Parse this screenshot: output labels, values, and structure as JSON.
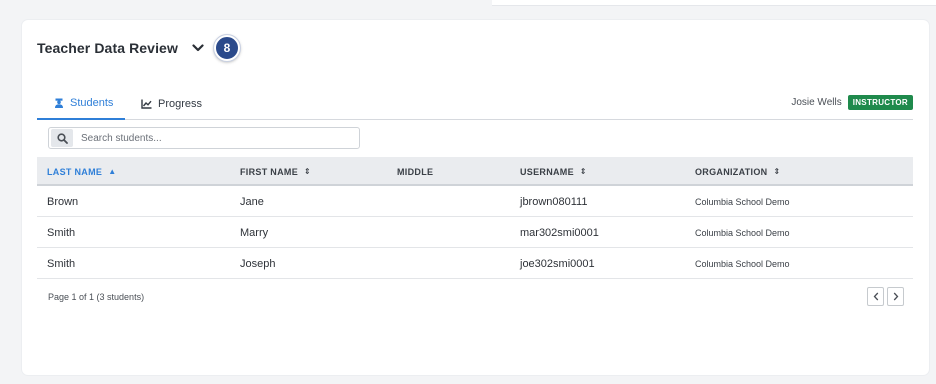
{
  "header": {
    "title": "Teacher Data Review",
    "badge_count": "8"
  },
  "tabs": [
    {
      "label": "Students",
      "icon": "student-icon",
      "active": true
    },
    {
      "label": "Progress",
      "icon": "chart-line-icon",
      "active": false
    }
  ],
  "user": {
    "name": "Josie Wells",
    "role": "INSTRUCTOR"
  },
  "search": {
    "placeholder": "Search students...",
    "value": ""
  },
  "table": {
    "columns": [
      {
        "label": "LAST NAME",
        "sort": "▲"
      },
      {
        "label": "FIRST NAME",
        "sort": "⇕"
      },
      {
        "label": "MIDDLE",
        "sort": ""
      },
      {
        "label": "USERNAME",
        "sort": "⇕"
      },
      {
        "label": "ORGANIZATION",
        "sort": "⇕"
      }
    ],
    "rows": [
      {
        "last": "Brown",
        "first": "Jane",
        "middle": "",
        "username": "jbrown080111",
        "org": "Columbia School Demo"
      },
      {
        "last": "Smith",
        "first": "Marry",
        "middle": "",
        "username": "mar302smi0001",
        "org": "Columbia School Demo"
      },
      {
        "last": "Smith",
        "first": "Joseph",
        "middle": "",
        "username": "joe302smi0001",
        "org": "Columbia School Demo"
      }
    ]
  },
  "footer": {
    "page_info": "Page 1 of 1 (3 students)"
  },
  "colors": {
    "accent": "#2f7fd8",
    "badge": "#2b4a8b",
    "role_badge": "#1f8a4c"
  }
}
